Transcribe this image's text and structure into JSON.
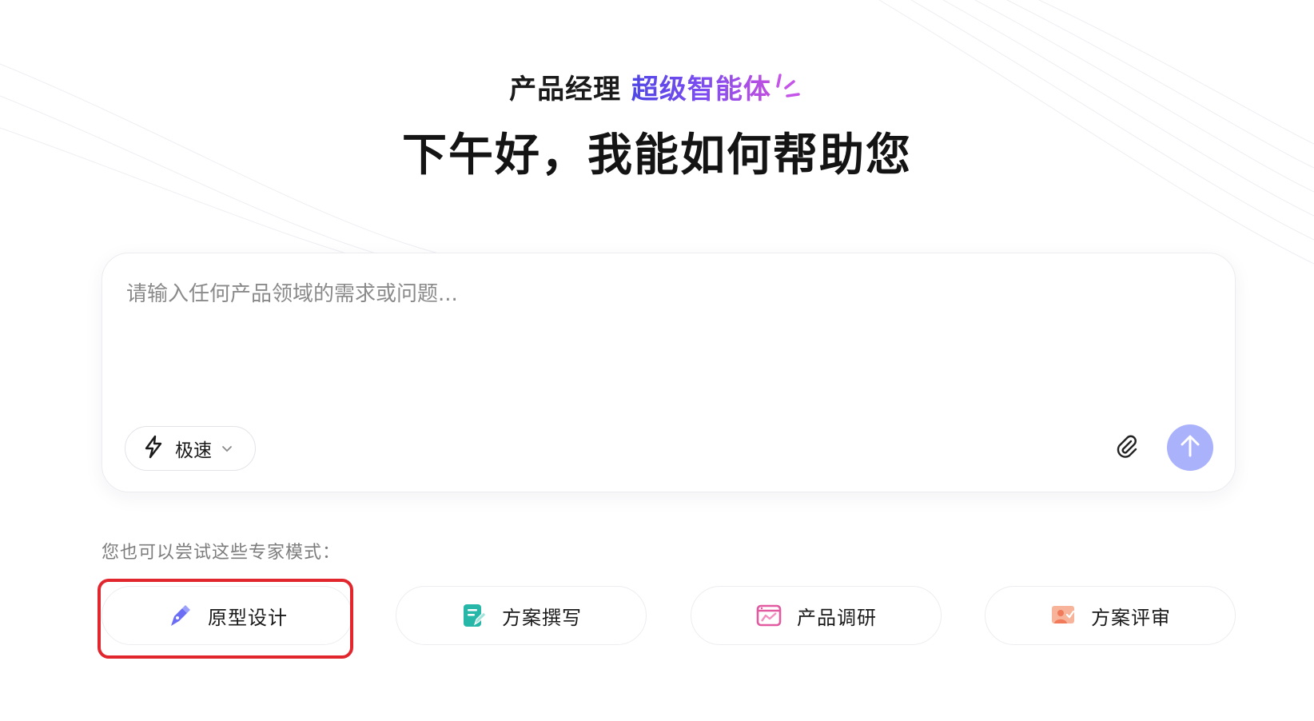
{
  "header": {
    "subtitle_plain": "产品经理",
    "subtitle_accent": "超级智能体",
    "title": "下午好，我能如何帮助您"
  },
  "composer": {
    "placeholder": "请输入任何产品领域的需求或问题...",
    "mode_label": "极速",
    "mode_icon": "lightning-icon",
    "attach_icon": "paperclip-icon",
    "send_icon": "arrow-up-icon"
  },
  "experts": {
    "hint": "您也可以尝试这些专家模式：",
    "items": [
      {
        "label": "原型设计",
        "icon": "pen-nib-icon",
        "color": "#6b6ef5"
      },
      {
        "label": "方案撰写",
        "icon": "document-edit-icon",
        "color": "#27b7a8"
      },
      {
        "label": "产品调研",
        "icon": "chart-window-icon",
        "color": "#e25aa0"
      },
      {
        "label": "方案评审",
        "icon": "presentation-user-icon",
        "color": "#f07a5a"
      }
    ]
  },
  "colors": {
    "accent_start": "#4f46e5",
    "accent_end": "#c04fe0",
    "send_button": "#a9b2fb",
    "highlight_border": "#e1262d"
  }
}
